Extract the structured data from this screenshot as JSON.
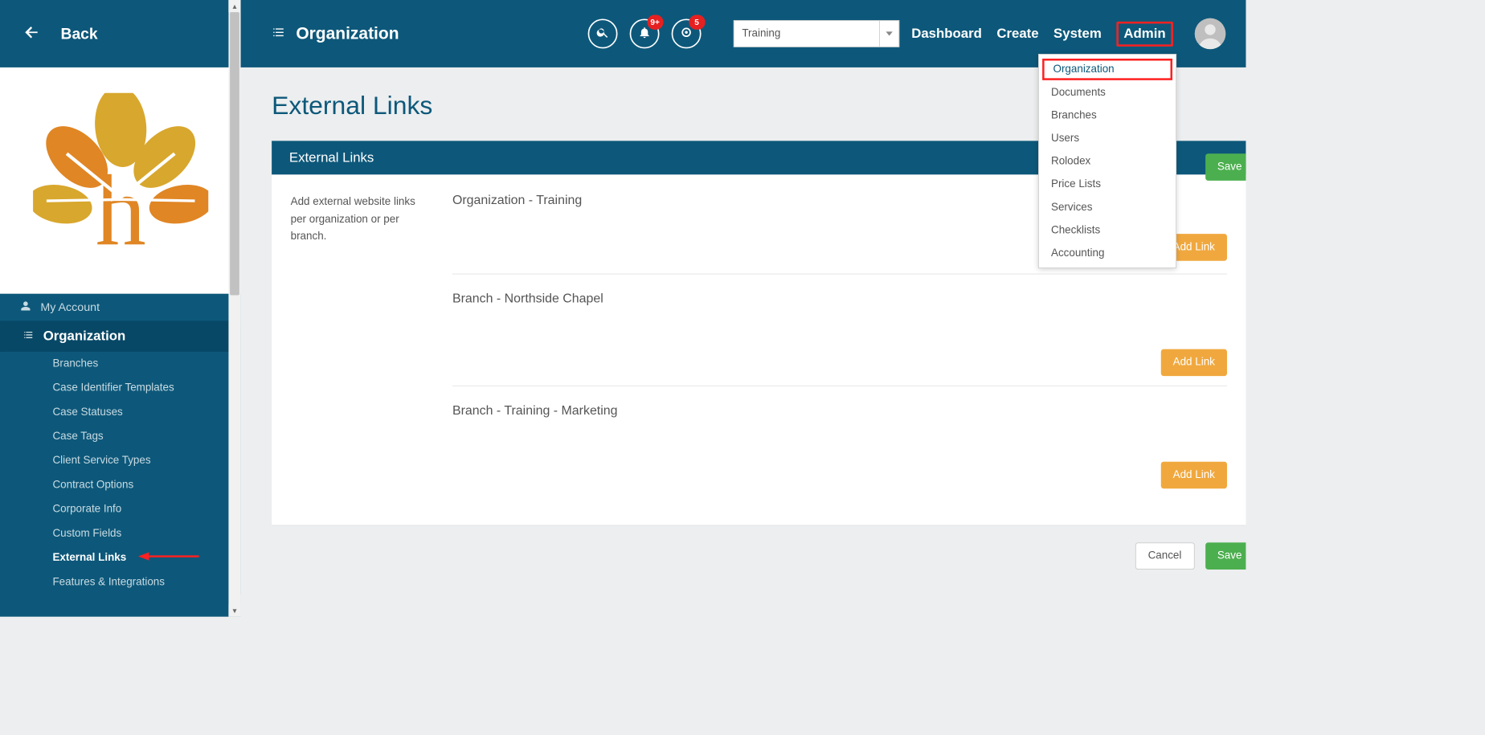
{
  "sidebar": {
    "back_label": "Back",
    "nav_my_account": "My Account",
    "nav_organization": "Organization",
    "subnav": [
      "Branches",
      "Case Identifier Templates",
      "Case Statuses",
      "Case Tags",
      "Client Service Types",
      "Contract Options",
      "Corporate Info",
      "Custom Fields",
      "External Links",
      "Features & Integrations"
    ],
    "subnav_active_index": 8
  },
  "topbar": {
    "title": "Organization",
    "badges": {
      "notifications": "9+",
      "alerts": "5"
    },
    "org_select_value": "Training",
    "links": [
      "Dashboard",
      "Create",
      "System",
      "Admin"
    ],
    "admin_highlight_index": 3,
    "dropdown": [
      "Organization",
      "Documents",
      "Branches",
      "Users",
      "Rolodex",
      "Price Lists",
      "Services",
      "Checklists",
      "Accounting"
    ],
    "dropdown_highlight_index": 0
  },
  "page": {
    "title": "External Links",
    "panel_title": "External Links",
    "help_text": "Add external website links per organization or per branch.",
    "sections": [
      {
        "title": "Organization - Training"
      },
      {
        "title": "Branch - Northside Chapel"
      },
      {
        "title": "Branch - Training - Marketing"
      }
    ],
    "add_link_label": "Add Link",
    "cancel_label": "Cancel",
    "save_label": "Save"
  }
}
